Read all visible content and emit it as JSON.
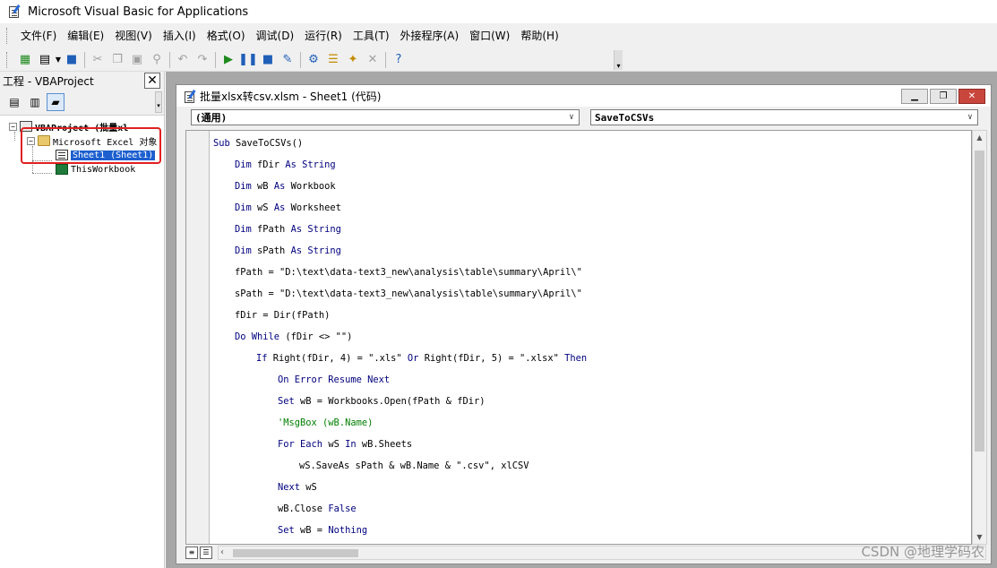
{
  "window": {
    "title": "Microsoft Visual Basic for Applications"
  },
  "menu": [
    "文件(F)",
    "编辑(E)",
    "视图(V)",
    "插入(I)",
    "格式(O)",
    "调试(D)",
    "运行(R)",
    "工具(T)",
    "外接程序(A)",
    "窗口(W)",
    "帮助(H)"
  ],
  "toolbar": {
    "icons": [
      "excel-view-icon",
      "insert-module-icon",
      "save-icon",
      "cut-icon",
      "copy-icon",
      "paste-icon",
      "find-icon",
      "undo-icon",
      "redo-icon",
      "run-icon",
      "break-icon",
      "reset-icon",
      "design-mode-icon",
      "project-explorer-icon",
      "properties-icon",
      "object-browser-icon",
      "toolbox-icon",
      "help-icon"
    ]
  },
  "project": {
    "title": "工程 - VBAProject",
    "tree": [
      {
        "label": "VBAProject (批量xl",
        "level": 0,
        "expander": "−"
      },
      {
        "label": "Microsoft Excel 对象",
        "level": 1,
        "expander": "−"
      },
      {
        "label": "Sheet1 (Sheet1)",
        "level": 2,
        "selected": true
      },
      {
        "label": "ThisWorkbook",
        "level": 2
      }
    ]
  },
  "code_window": {
    "title": "批量xlsx转csv.xlsm - Sheet1 (代码)",
    "object_combo": "(通用)",
    "proc_combo": "SaveToCSVs",
    "lines": [
      {
        "indent": 0,
        "parts": [
          {
            "t": "kw",
            "v": "Sub "
          },
          {
            "t": "tx",
            "v": "SaveToCSVs()"
          }
        ]
      },
      {
        "indent": 1,
        "parts": [
          {
            "t": "kw",
            "v": "Dim "
          },
          {
            "t": "tx",
            "v": "fDir "
          },
          {
            "t": "kw",
            "v": "As String"
          }
        ]
      },
      {
        "indent": 1,
        "parts": [
          {
            "t": "kw",
            "v": "Dim "
          },
          {
            "t": "tx",
            "v": "wB "
          },
          {
            "t": "kw",
            "v": "As "
          },
          {
            "t": "tx",
            "v": "Workbook"
          }
        ]
      },
      {
        "indent": 1,
        "parts": [
          {
            "t": "kw",
            "v": "Dim "
          },
          {
            "t": "tx",
            "v": "wS "
          },
          {
            "t": "kw",
            "v": "As "
          },
          {
            "t": "tx",
            "v": "Worksheet"
          }
        ]
      },
      {
        "indent": 1,
        "parts": [
          {
            "t": "kw",
            "v": "Dim "
          },
          {
            "t": "tx",
            "v": "fPath "
          },
          {
            "t": "kw",
            "v": "As String"
          }
        ]
      },
      {
        "indent": 1,
        "parts": [
          {
            "t": "kw",
            "v": "Dim "
          },
          {
            "t": "tx",
            "v": "sPath "
          },
          {
            "t": "kw",
            "v": "As String"
          }
        ]
      },
      {
        "indent": 1,
        "parts": [
          {
            "t": "tx",
            "v": "fPath = \"D:\\text\\data-text3_new\\analysis\\table\\summary\\April\\\""
          }
        ]
      },
      {
        "indent": 1,
        "parts": [
          {
            "t": "tx",
            "v": "sPath = \"D:\\text\\data-text3_new\\analysis\\table\\summary\\April\\\""
          }
        ]
      },
      {
        "indent": 1,
        "parts": [
          {
            "t": "tx",
            "v": "fDir = Dir(fPath)"
          }
        ]
      },
      {
        "indent": 1,
        "parts": [
          {
            "t": "kw",
            "v": "Do While "
          },
          {
            "t": "tx",
            "v": "(fDir <> \"\")"
          }
        ]
      },
      {
        "indent": 2,
        "parts": [
          {
            "t": "kw",
            "v": "If "
          },
          {
            "t": "tx",
            "v": "Right(fDir, 4) = \".xls\" "
          },
          {
            "t": "kw",
            "v": "Or "
          },
          {
            "t": "tx",
            "v": "Right(fDir, 5) = \".xlsx\" "
          },
          {
            "t": "kw",
            "v": "Then"
          }
        ]
      },
      {
        "indent": 3,
        "parts": [
          {
            "t": "kw",
            "v": "On Error Resume Next"
          }
        ]
      },
      {
        "indent": 3,
        "parts": [
          {
            "t": "kw",
            "v": "Set "
          },
          {
            "t": "tx",
            "v": "wB = Workbooks.Open(fPath & fDir)"
          }
        ]
      },
      {
        "indent": 3,
        "parts": [
          {
            "t": "cm",
            "v": "'MsgBox (wB.Name)"
          }
        ]
      },
      {
        "indent": 3,
        "parts": [
          {
            "t": "kw",
            "v": "For Each "
          },
          {
            "t": "tx",
            "v": "wS "
          },
          {
            "t": "kw",
            "v": "In "
          },
          {
            "t": "tx",
            "v": "wB.Sheets"
          }
        ]
      },
      {
        "indent": 4,
        "parts": [
          {
            "t": "tx",
            "v": "wS.SaveAs sPath & wB.Name & \".csv\", xlCSV"
          }
        ]
      },
      {
        "indent": 3,
        "parts": [
          {
            "t": "kw",
            "v": "Next "
          },
          {
            "t": "tx",
            "v": "wS"
          }
        ]
      },
      {
        "indent": 3,
        "parts": [
          {
            "t": "tx",
            "v": "wB.Close "
          },
          {
            "t": "kw",
            "v": "False"
          }
        ]
      },
      {
        "indent": 3,
        "parts": [
          {
            "t": "kw",
            "v": "Set "
          },
          {
            "t": "tx",
            "v": "wB = "
          },
          {
            "t": "kw",
            "v": "Nothing"
          }
        ]
      }
    ]
  },
  "watermark": "CSDN @地理学码农",
  "colors": {
    "keyword": "#00007f",
    "text": "#000000",
    "comment": "#007f00",
    "selection": "#1c5fcf",
    "highlight_box": "#e02020"
  }
}
